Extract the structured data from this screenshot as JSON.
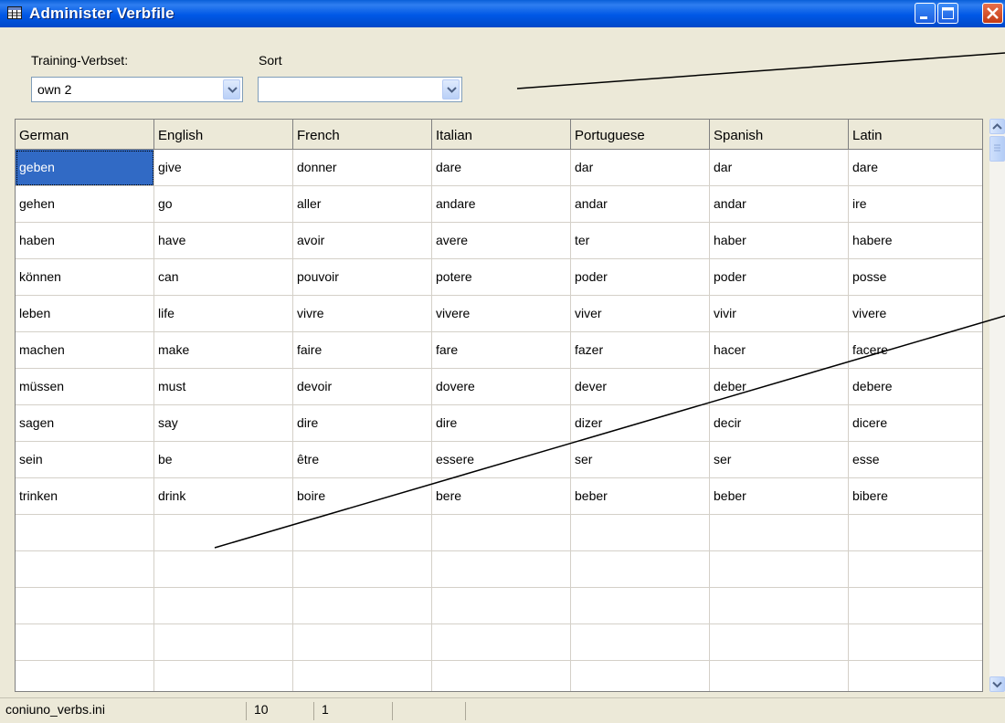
{
  "window": {
    "title": "Administer Verbfile"
  },
  "toolbar": {
    "verbset_label": "Training-Verbset:",
    "verbset_value": "own 2",
    "sort_label": "Sort",
    "sort_value": ""
  },
  "grid": {
    "columns": [
      "German",
      "English",
      "French",
      "Italian",
      "Portuguese",
      "Spanish",
      "Latin"
    ],
    "rows": [
      [
        "geben",
        "give",
        "donner",
        "dare",
        "dar",
        "dar",
        "dare"
      ],
      [
        "gehen",
        "go",
        "aller",
        "andare",
        "andar",
        "andar",
        "ire"
      ],
      [
        "haben",
        "have",
        "avoir",
        "avere",
        "ter",
        "haber",
        "habere"
      ],
      [
        "können",
        "can",
        "pouvoir",
        "potere",
        "poder",
        "poder",
        "posse"
      ],
      [
        "leben",
        "life",
        "vivre",
        "vivere",
        "viver",
        "vivir",
        "vivere"
      ],
      [
        "machen",
        "make",
        "faire",
        "fare",
        "fazer",
        "hacer",
        "facere"
      ],
      [
        "müssen",
        "must",
        "devoir",
        "dovere",
        "dever",
        "deber",
        "debere"
      ],
      [
        "sagen",
        "say",
        "dire",
        "dire",
        "dizer",
        "decir",
        "dicere"
      ],
      [
        "sein",
        "be",
        "être",
        "essere",
        "ser",
        "ser",
        "esse"
      ],
      [
        "trinken",
        "drink",
        "boire",
        "bere",
        "beber",
        "beber",
        "bibere"
      ],
      [
        "",
        "",
        "",
        "",
        "",
        "",
        ""
      ],
      [
        "",
        "",
        "",
        "",
        "",
        "",
        ""
      ],
      [
        "",
        "",
        "",
        "",
        "",
        "",
        ""
      ],
      [
        "",
        "",
        "",
        "",
        "",
        "",
        ""
      ],
      [
        "",
        "",
        "",
        "",
        "",
        "",
        ""
      ]
    ],
    "selected_row": 0,
    "selected_col": 0
  },
  "status": {
    "file": "coniuno_verbs.ini",
    "count": "10",
    "position": "1"
  },
  "colors": {
    "titlebar": "#0058e6",
    "selection": "#316ac5",
    "face": "#ece9d8"
  },
  "icons": {
    "title": "table-icon",
    "minimize": "minimize-icon",
    "maximize": "maximize-icon",
    "close": "close-icon"
  }
}
